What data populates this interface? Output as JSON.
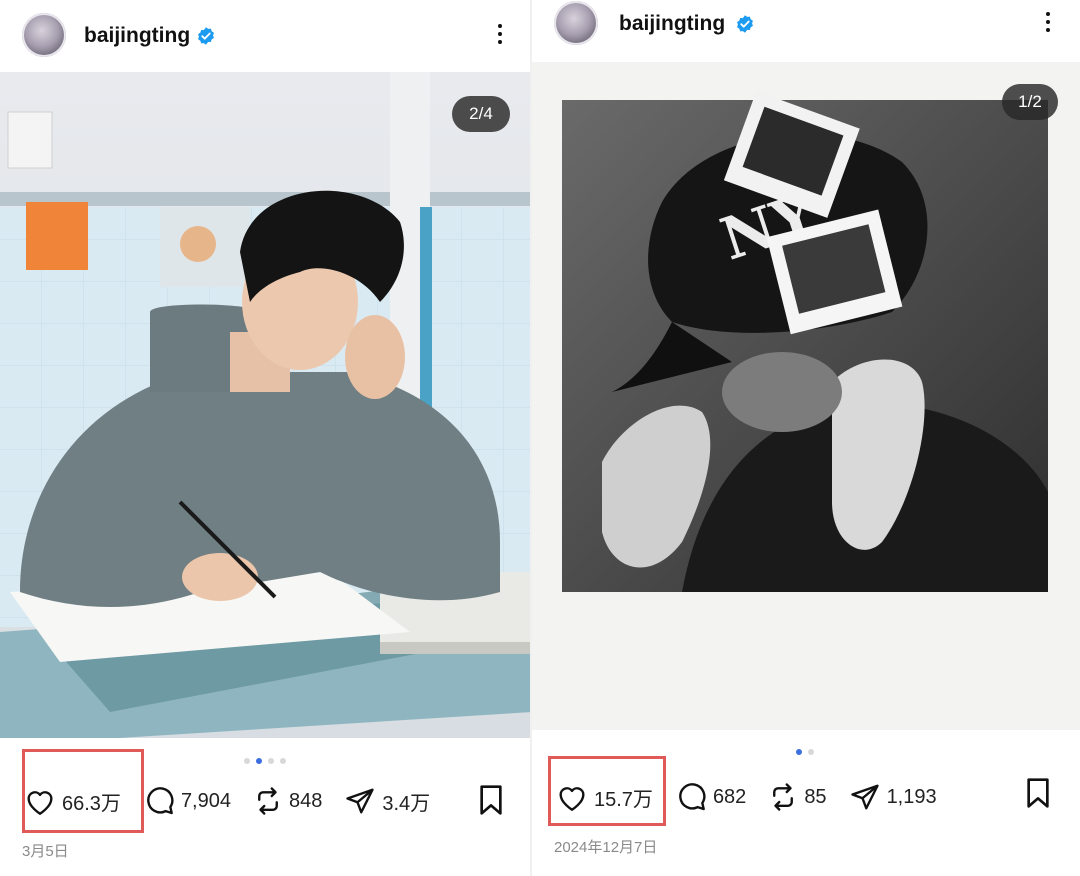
{
  "posts": [
    {
      "username": "baijingting",
      "image_counter": "2/4",
      "likes": "66.3万",
      "comments": "7,904",
      "reposts": "848",
      "shares": "3.4万",
      "date": "3月5日",
      "photo_icon": "classroom-photo-color"
    },
    {
      "username": "baijingting",
      "image_counter": "1/2",
      "likes": "15.7万",
      "comments": "682",
      "reposts": "85",
      "shares": "1,193",
      "date": "2024年12月7日",
      "photo_icon": "polaroid-photo-bw"
    }
  ],
  "colors": {
    "highlight": "#e05a5a",
    "verified": "#1d9bf0",
    "dot_active": "#3b6fe0"
  }
}
